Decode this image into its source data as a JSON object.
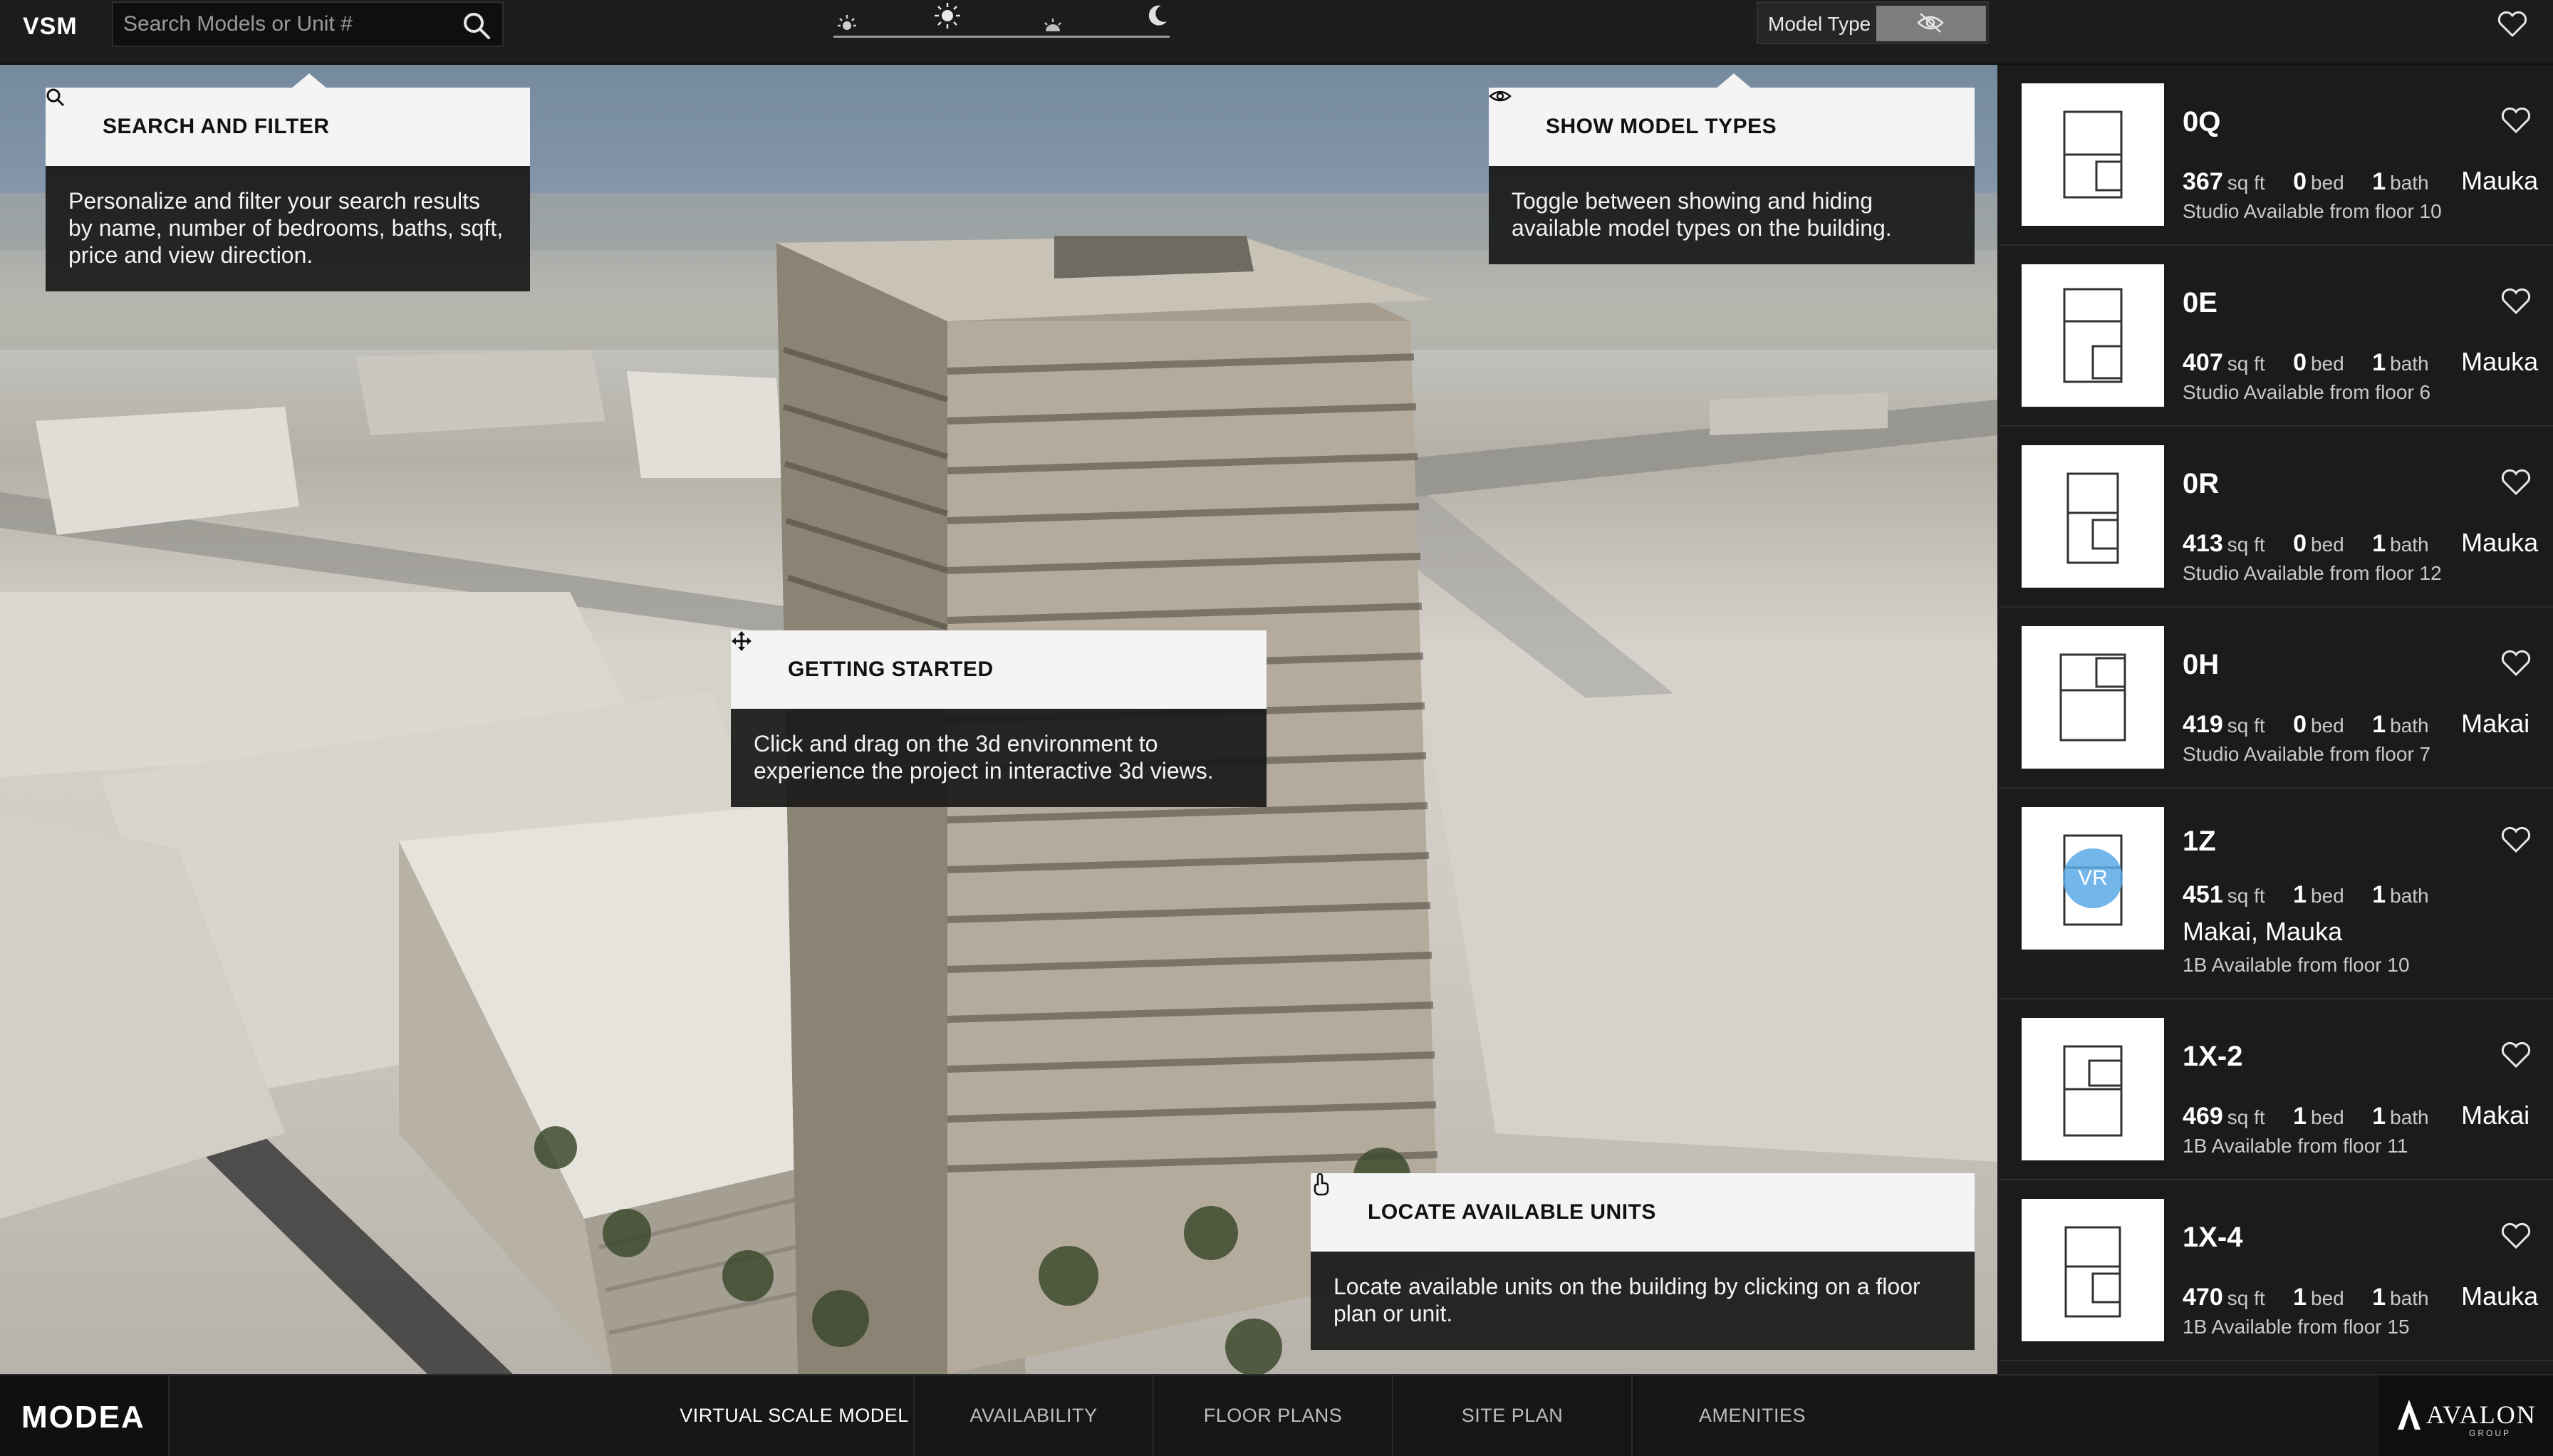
{
  "header": {
    "logo": "VSM",
    "search_placeholder": "Search Models or Unit #",
    "time_of_day_icons": [
      "sunrise-icon",
      "sun-icon",
      "sunset-icon",
      "moon-icon"
    ],
    "model_type_label": "Model Type",
    "model_type_toggle_icon": "eye-slash-icon"
  },
  "tooltips": {
    "search": {
      "title": "SEARCH AND FILTER",
      "body": "Personalize and filter your search results by name, number of bedrooms, baths, sqft, price and view direction."
    },
    "model_types": {
      "title": "SHOW MODEL TYPES",
      "body": "Toggle between showing and hiding available model types on the building."
    },
    "getting_started": {
      "title": "GETTING STARTED",
      "body": "Click and drag on the 3d environment to experience the project in interactive 3d views."
    },
    "locate_units": {
      "title": "LOCATE AVAILABLE UNITS",
      "body": "Locate available units on the building by clicking on a floor plan or unit."
    }
  },
  "units": [
    {
      "name": "0Q",
      "sqft": "367",
      "beds": "0",
      "baths": "1",
      "view": "Mauka",
      "type": "Studio",
      "avail": "Studio Available from floor 10"
    },
    {
      "name": "0E",
      "sqft": "407",
      "beds": "0",
      "baths": "1",
      "view": "Mauka",
      "type": "Studio",
      "avail": "Studio Available from floor 6"
    },
    {
      "name": "0R",
      "sqft": "413",
      "beds": "0",
      "baths": "1",
      "view": "Mauka",
      "type": "Studio",
      "avail": "Studio Available from floor 12"
    },
    {
      "name": "0H",
      "sqft": "419",
      "beds": "0",
      "baths": "1",
      "view": "Makai",
      "type": "Studio",
      "avail": "Studio Available from floor 7"
    },
    {
      "name": "1Z",
      "sqft": "451",
      "beds": "1",
      "baths": "1",
      "view": "Makai, Mauka",
      "type": "1B",
      "avail": "1B Available from floor 10",
      "vr": "VR"
    },
    {
      "name": "1X-2",
      "sqft": "469",
      "beds": "1",
      "baths": "1",
      "view": "Makai",
      "type": "1B",
      "avail": "1B Available from floor 11"
    },
    {
      "name": "1X-4",
      "sqft": "470",
      "beds": "1",
      "baths": "1",
      "view": "Mauka",
      "type": "1B",
      "avail": "1B Available from floor 15"
    }
  ],
  "unit_labels": {
    "sqft": "sq ft",
    "bed": "bed",
    "bath": "bath"
  },
  "nav": {
    "brand": "MODEA",
    "items": [
      "VIRTUAL SCALE MODEL",
      "AVAILABILITY",
      "FLOOR PLANS",
      "SITE PLAN",
      "AMENITIES"
    ],
    "active": "VIRTUAL SCALE MODEL",
    "partner": "AVALON",
    "partner_sub": "GROUP"
  },
  "colors": {
    "background": "#1b1b1b",
    "tooltip_head": "#f4f4f4",
    "tooltip_body": "#1a1a1a",
    "vr_badge": "#5aaae6"
  }
}
